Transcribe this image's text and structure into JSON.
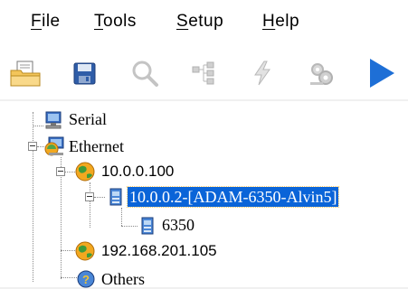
{
  "menu": {
    "file": {
      "mnemonic": "F",
      "rest": "ile"
    },
    "tools": {
      "mnemonic": "T",
      "rest": "ools"
    },
    "setup": {
      "mnemonic": "S",
      "rest": "etup"
    },
    "help": {
      "mnemonic": "H",
      "rest": "elp"
    }
  },
  "toolbar": {
    "buttons": [
      "open-icon",
      "save-icon",
      "search-icon",
      "network-tree-icon",
      "lightning-icon",
      "gears-icon",
      "run-icon"
    ]
  },
  "tree": {
    "serial": "Serial",
    "ethernet": "Ethernet",
    "host1": "10.0.0.100",
    "device1": "10.0.0.2-[ADAM-6350-Alvin5]",
    "module1": "6350",
    "host2": "192.168.201.105",
    "others": "Others"
  },
  "colors": {
    "selection": "#0a64d8",
    "run_arrow": "#1e6fd6"
  }
}
